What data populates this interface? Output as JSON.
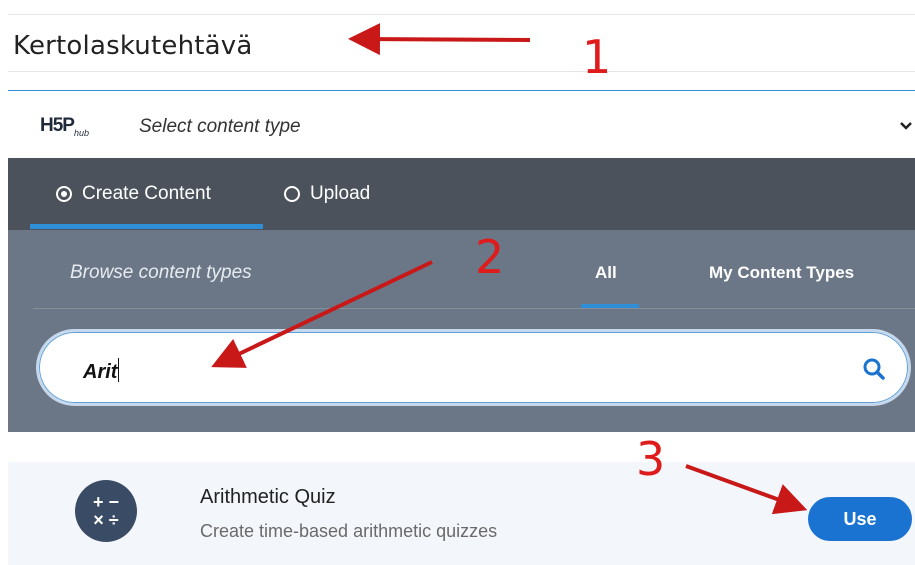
{
  "title": {
    "text": "Kertolaskutehtävä"
  },
  "hub": {
    "logo_main": "H5P",
    "logo_sub": "hub",
    "select_label": "Select content type"
  },
  "tabs": [
    {
      "label": "Create Content",
      "selected": true
    },
    {
      "label": "Upload",
      "selected": false
    }
  ],
  "browse": {
    "label": "Browse content types",
    "filters": [
      {
        "label": "All",
        "active": true
      },
      {
        "label": "My Content Types",
        "active": false
      }
    ]
  },
  "search": {
    "value": "Arit"
  },
  "result": {
    "icon_top": "+ −",
    "icon_bottom": "× ÷",
    "title": "Arithmetic Quiz",
    "description": "Create time-based arithmetic quizzes",
    "use_label": "Use"
  },
  "annotations": {
    "one": "1",
    "two": "2",
    "three": "3",
    "color": "#e01b1b"
  },
  "colors": {
    "accent": "#2f8fd6",
    "tab_bar": "#4b525c",
    "browse_panel": "#6b7787",
    "use_button": "#1a73d1"
  }
}
